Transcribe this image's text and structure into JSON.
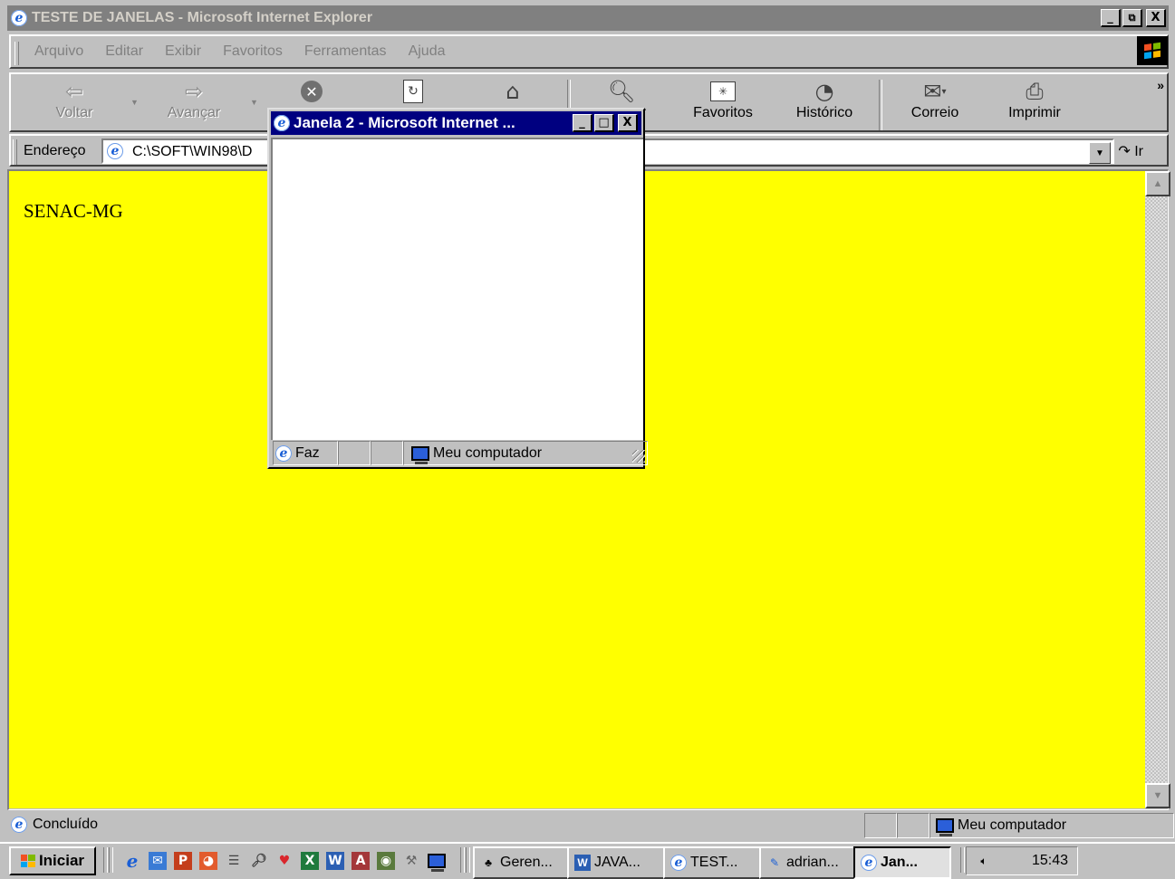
{
  "main_window": {
    "title": "TESTE DE JANELAS - Microsoft Internet Explorer",
    "caption_buttons": {
      "minimize": "_",
      "maximize": "□",
      "close": "X"
    }
  },
  "menu": [
    "Arquivo",
    "Editar",
    "Exibir",
    "Favoritos",
    "Ferramentas",
    "Ajuda"
  ],
  "toolbar": {
    "buttons": [
      {
        "label": "Voltar",
        "icon": "back-arrow-icon",
        "enabled": false
      },
      {
        "label": "Avançar",
        "icon": "forward-arrow-icon",
        "enabled": false
      },
      {
        "label": "",
        "icon": "stop-icon",
        "enabled": true
      },
      {
        "label": "",
        "icon": "refresh-icon",
        "enabled": true
      },
      {
        "label": "",
        "icon": "home-icon",
        "enabled": true
      },
      {
        "label": "ar",
        "icon": "search-icon",
        "enabled": true
      },
      {
        "label": "Favoritos",
        "icon": "favorites-icon",
        "enabled": true
      },
      {
        "label": "Histórico",
        "icon": "history-icon",
        "enabled": true
      },
      {
        "label": "Correio",
        "icon": "mail-icon",
        "enabled": true
      },
      {
        "label": "Imprimir",
        "icon": "print-icon",
        "enabled": true
      }
    ],
    "overflow": "»"
  },
  "address_bar": {
    "label": "Endereço",
    "value": "C:\\SOFT\\WIN98\\D",
    "go_label": "Ir"
  },
  "page": {
    "text": "SENAC-MG",
    "background": "#ffff00"
  },
  "status_bar": {
    "text": "Concluído",
    "zone": "Meu computador"
  },
  "popup": {
    "title": "Janela 2 - Microsoft Internet ...",
    "status_text": "Faz",
    "zone": "Meu computador",
    "title_color": "#000080"
  },
  "taskbar": {
    "start_label": "Iniciar",
    "quick_launch": [
      "ie-icon",
      "outlook-icon",
      "powerpoint-icon",
      "schedule-icon",
      "notepad-icon",
      "explorer-icon",
      "balloon-icon",
      "excel-icon",
      "word-icon",
      "access-icon",
      "image-icon",
      "tool-icon",
      "monitor-icon"
    ],
    "tasks": [
      {
        "label": "Geren...",
        "active": false
      },
      {
        "label": "JAVA...",
        "active": false
      },
      {
        "label": "TEST...",
        "active": false
      },
      {
        "label": "adrian...",
        "active": false
      },
      {
        "label": "Jan...",
        "active": true
      }
    ],
    "clock": "15:43"
  }
}
